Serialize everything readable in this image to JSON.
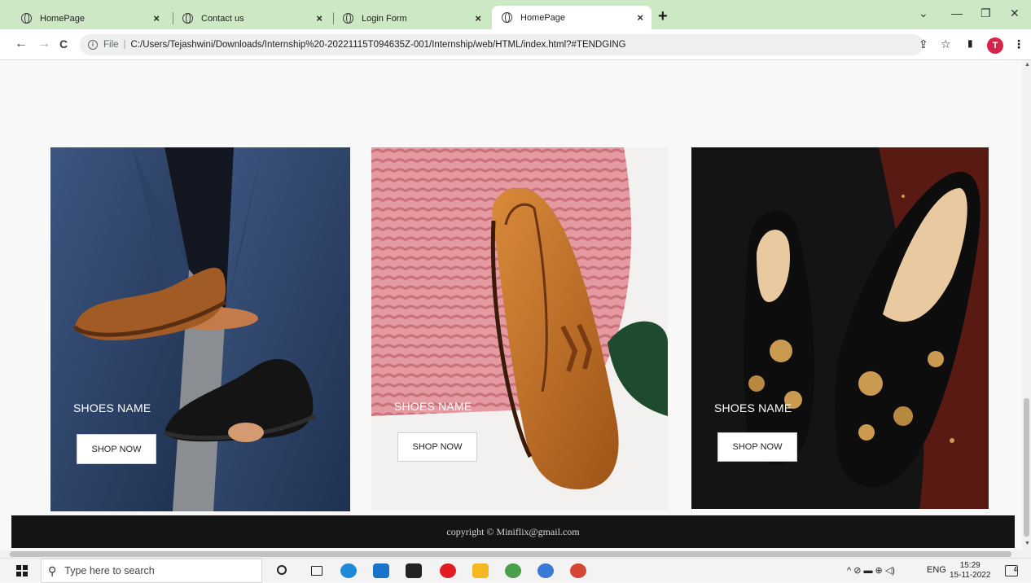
{
  "browser": {
    "tabs": [
      {
        "title": "HomePage",
        "active": false
      },
      {
        "title": "Contact us",
        "active": false
      },
      {
        "title": "Login Form",
        "active": false
      },
      {
        "title": "HomePage",
        "active": true
      }
    ],
    "tab_close": "×",
    "new_tab": "+",
    "window_controls": {
      "chevron": "⌄",
      "minimize": "—",
      "restore": "❐",
      "close": "✕"
    },
    "nav": {
      "back": "←",
      "forward": "→",
      "reload": "C"
    },
    "address": {
      "scheme_label": "File",
      "separator": "|",
      "url": "C:/Users/Tejashwini/Downloads/Internship%20-20221115T094635Z-001/Internship/web/HTML/index.html?#TENDGING"
    },
    "address_icons": {
      "share": "⇪",
      "star": "☆"
    },
    "sidepanel_icon": "▮",
    "profile_initial": "T",
    "menu_icon": "⋮"
  },
  "page": {
    "cards": [
      {
        "name": "SHOES NAME",
        "button": "SHOP NOW",
        "theme": "blue-suit-brogues"
      },
      {
        "name": "SHOES NAME",
        "button": "SHOP NOW",
        "theme": "tan-tassel-loafer"
      },
      {
        "name": "SHOES NAME",
        "button": "SHOP NOW",
        "theme": "embroidered-slipons"
      }
    ],
    "footer": "copyright © Miniflix@gmail.com"
  },
  "taskbar": {
    "search_placeholder": "Type here to search",
    "language": "ENG",
    "time": "15:29",
    "date": "15-11-2022",
    "notifications": "4",
    "tray_symbols": "^ ⊘ ▬ ⊕ ◁)"
  },
  "colors": {
    "tabstrip": "#cce8c4",
    "footer_bg": "#141414",
    "accent_avatar": "#d5254a"
  }
}
